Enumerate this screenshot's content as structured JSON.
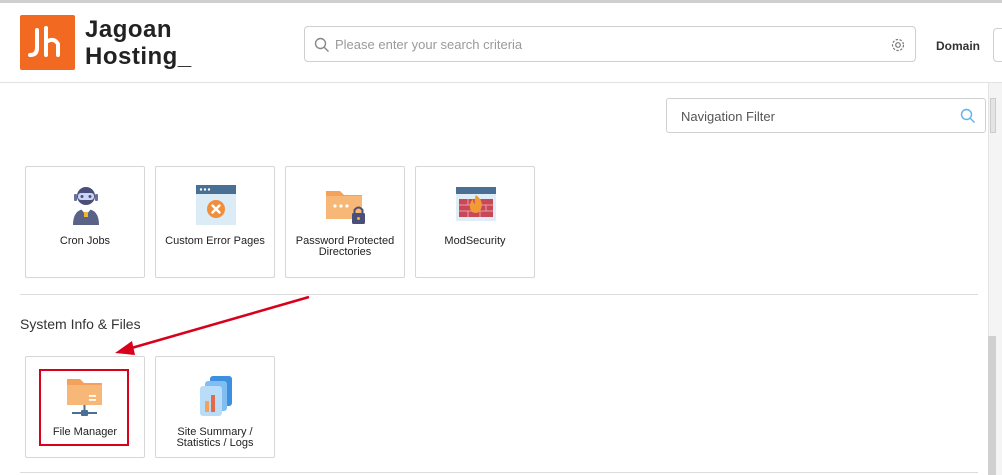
{
  "brand": {
    "line1": "Jagoan",
    "line2": "Hosting_",
    "accent": "#f26a21"
  },
  "search": {
    "placeholder": "Please enter your search criteria"
  },
  "header": {
    "domain_label": "Domain"
  },
  "nav_filter": {
    "placeholder": "Navigation Filter"
  },
  "security_tools": [
    {
      "label": "Cron Jobs",
      "icon": "robot-icon"
    },
    {
      "label": "Custom Error Pages",
      "icon": "browser-error-icon"
    },
    {
      "label": "Password Protected Directories",
      "icon": "locked-folder-icon"
    },
    {
      "label": "ModSecurity",
      "icon": "firewall-icon"
    }
  ],
  "system_section": {
    "title": "System Info & Files",
    "tools": [
      {
        "label": "File Manager",
        "icon": "folder-network-icon"
      },
      {
        "label": "Site Summary / Statistics / Logs",
        "icon": "stats-files-icon"
      }
    ]
  },
  "annotation": {
    "color": "#d9001b"
  }
}
